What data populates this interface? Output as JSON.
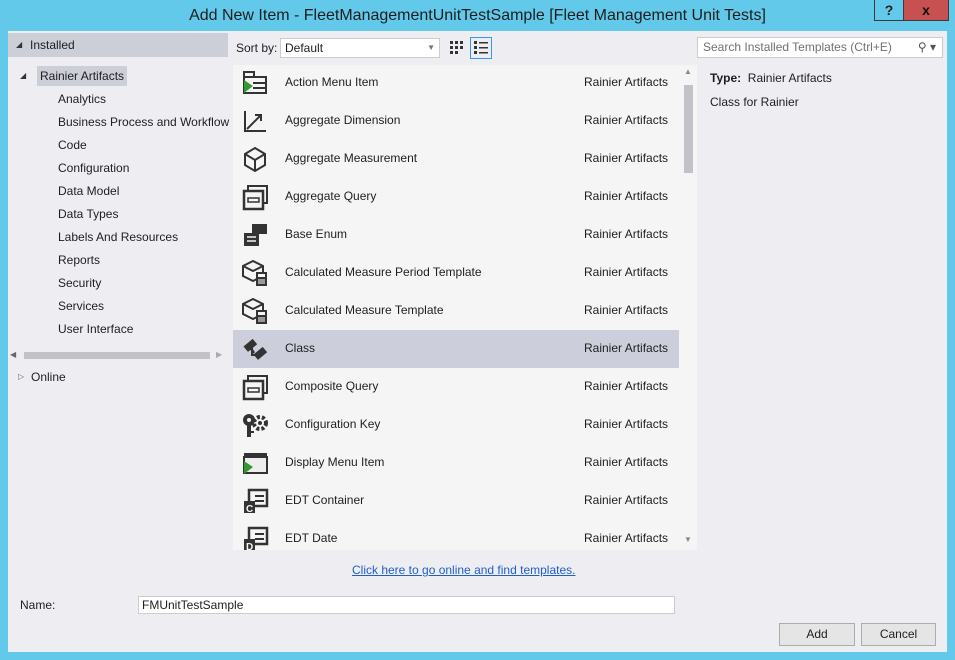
{
  "window": {
    "title": "Add New Item - FleetManagementUnitTestSample [Fleet Management Unit Tests]",
    "help": "?",
    "close": "x"
  },
  "sidebar": {
    "installed": "Installed",
    "root": "Rainier Artifacts",
    "items": [
      "Analytics",
      "Business Process and Workflow",
      "Code",
      "Configuration",
      "Data Model",
      "Data Types",
      "Labels And Resources",
      "Reports",
      "Security",
      "Services",
      "User Interface"
    ],
    "online": "Online"
  },
  "toolbar": {
    "sort_label": "Sort by:",
    "sort_value": "Default",
    "search_placeholder": "Search Installed Templates (Ctrl+E)"
  },
  "templates": [
    {
      "name": "Action Menu Item",
      "type": "Rainier Artifacts",
      "icon": "action-menu-item-icon"
    },
    {
      "name": "Aggregate Dimension",
      "type": "Rainier Artifacts",
      "icon": "aggregate-dimension-icon"
    },
    {
      "name": "Aggregate Measurement",
      "type": "Rainier Artifacts",
      "icon": "aggregate-measurement-icon"
    },
    {
      "name": "Aggregate Query",
      "type": "Rainier Artifacts",
      "icon": "query-icon"
    },
    {
      "name": "Base Enum",
      "type": "Rainier Artifacts",
      "icon": "base-enum-icon"
    },
    {
      "name": "Calculated Measure Period Template",
      "type": "Rainier Artifacts",
      "icon": "calculated-measure-icon"
    },
    {
      "name": "Calculated Measure Template",
      "type": "Rainier Artifacts",
      "icon": "calculated-measure-icon"
    },
    {
      "name": "Class",
      "type": "Rainier Artifacts",
      "icon": "class-icon",
      "selected": true
    },
    {
      "name": "Composite Query",
      "type": "Rainier Artifacts",
      "icon": "query-icon"
    },
    {
      "name": "Configuration Key",
      "type": "Rainier Artifacts",
      "icon": "configuration-key-icon"
    },
    {
      "name": "Display Menu Item",
      "type": "Rainier Artifacts",
      "icon": "display-menu-item-icon"
    },
    {
      "name": "EDT Container",
      "type": "Rainier Artifacts",
      "icon": "edt-container-icon"
    },
    {
      "name": "EDT Date",
      "type": "Rainier Artifacts",
      "icon": "edt-date-icon"
    }
  ],
  "details": {
    "type_label": "Type:",
    "type_value": "Rainier Artifacts",
    "description": "Class for Rainier"
  },
  "online_link": "Click here to go online and find templates.",
  "form": {
    "name_label": "Name:",
    "name_value": "FMUnitTestSample",
    "add": "Add",
    "cancel": "Cancel"
  },
  "colors": {
    "accent": "#63c9ea",
    "selection": "#cccedb",
    "close": "#c75050",
    "play_green": "#339933"
  }
}
